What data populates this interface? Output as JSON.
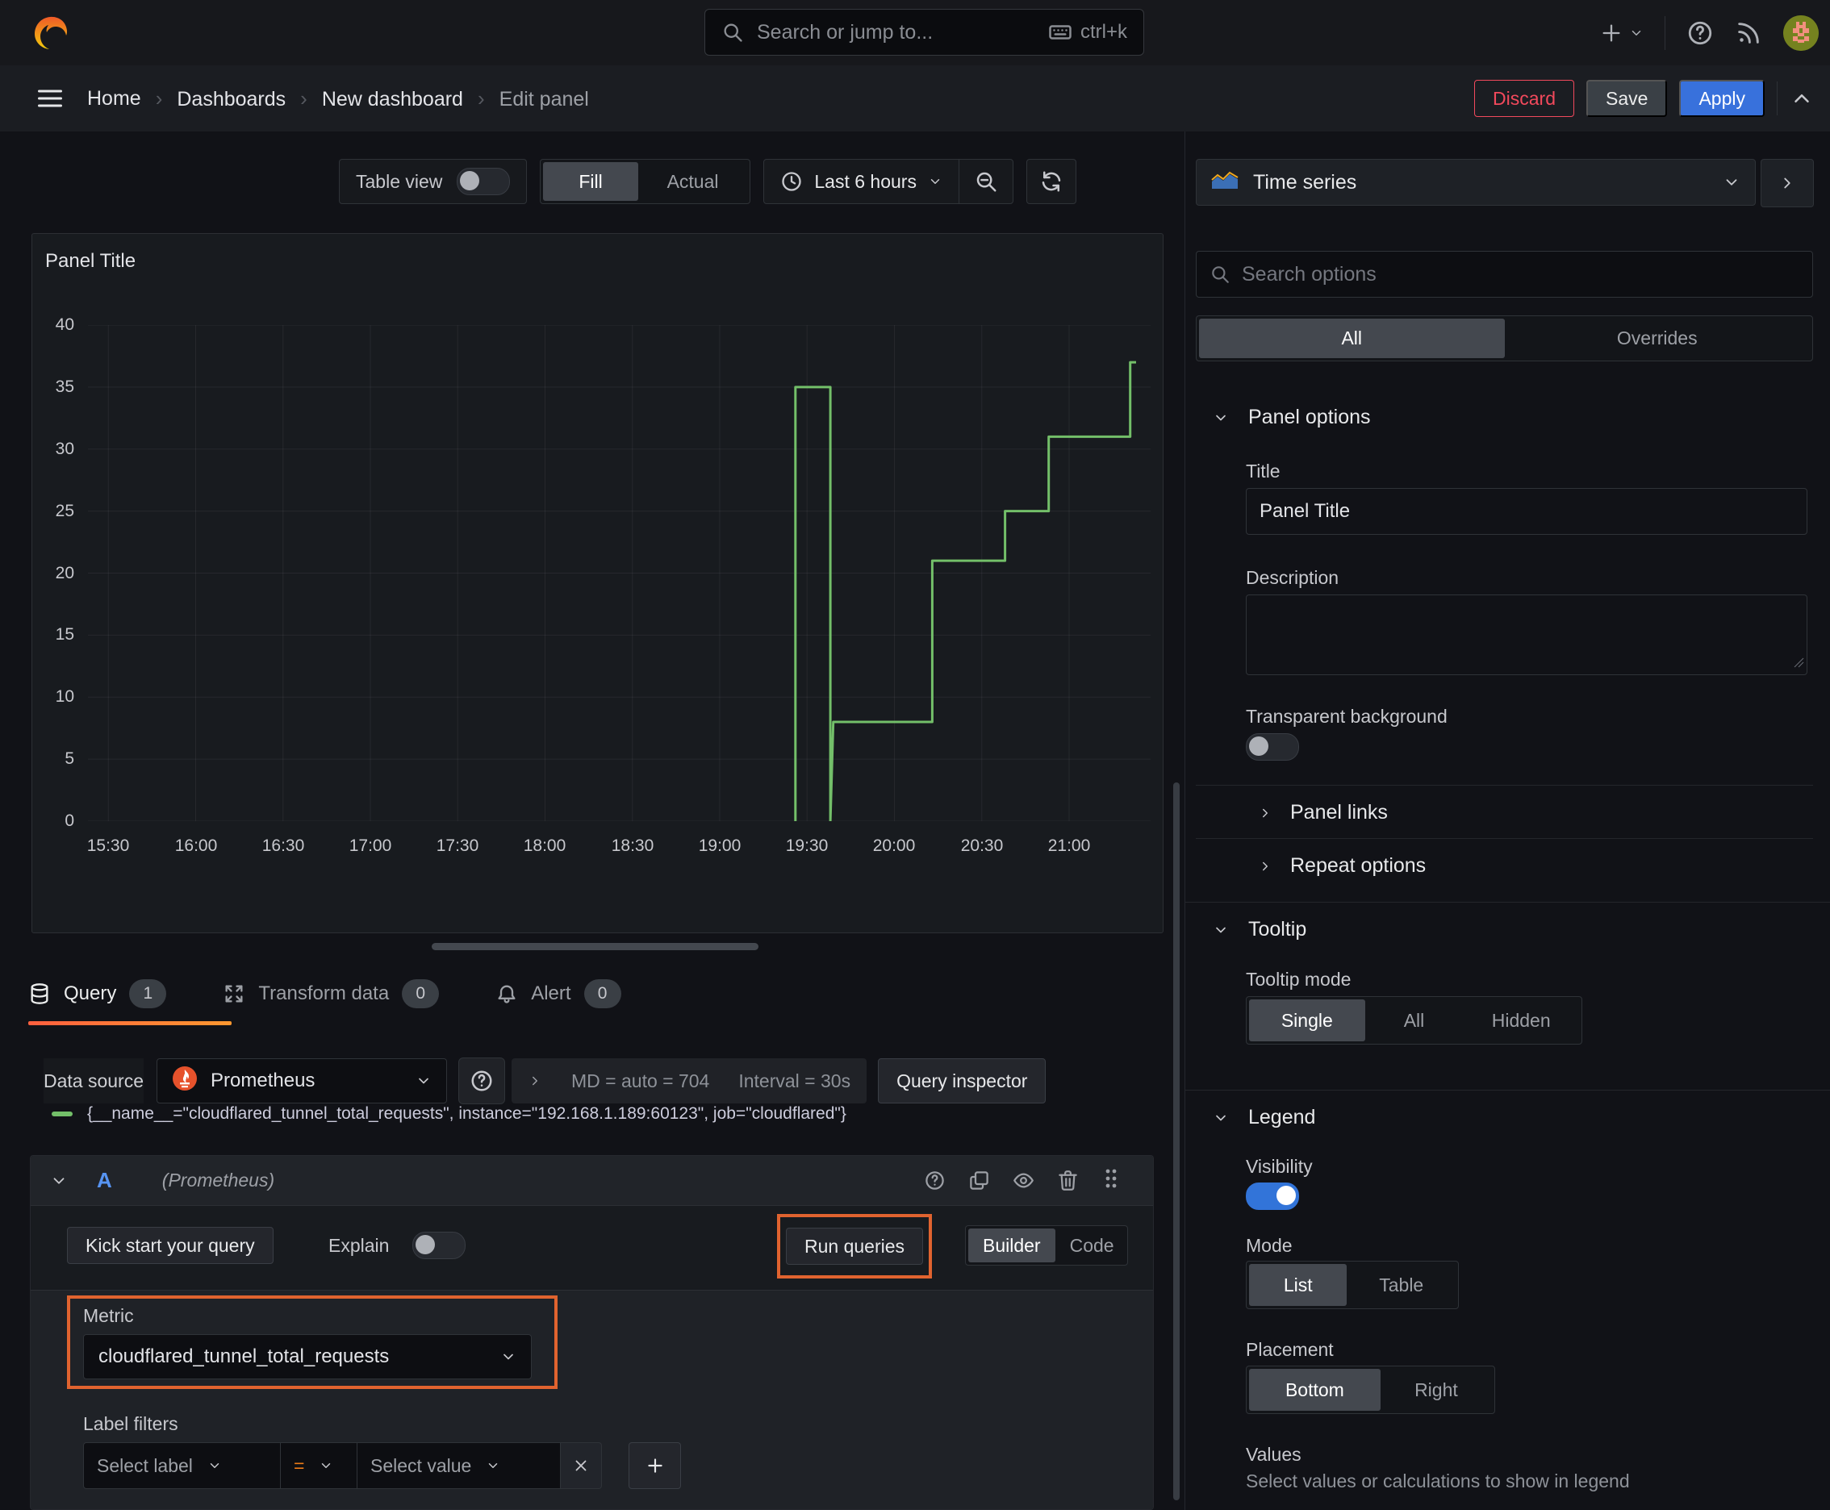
{
  "topbar": {
    "search_placeholder": "Search or jump to...",
    "shortcut": "ctrl+k"
  },
  "breadcrumb": {
    "items": [
      "Home",
      "Dashboards",
      "New dashboard",
      "Edit panel"
    ]
  },
  "actions": {
    "discard": "Discard",
    "save": "Save",
    "apply": "Apply"
  },
  "toolbar": {
    "table_view": "Table view",
    "fill": "Fill",
    "actual": "Actual",
    "time_range": "Last 6 hours"
  },
  "panel": {
    "title": "Panel Title"
  },
  "chart_data": {
    "type": "line",
    "title": "Panel Title",
    "x_ticks": [
      "15:30",
      "16:00",
      "16:30",
      "17:00",
      "17:30",
      "18:00",
      "18:30",
      "19:00",
      "19:30",
      "20:00",
      "20:30",
      "21:00"
    ],
    "x_tick_minutes": [
      930,
      960,
      990,
      1020,
      1050,
      1080,
      1110,
      1140,
      1170,
      1200,
      1230,
      1260
    ],
    "x_domain_minutes": [
      923,
      1288
    ],
    "y_ticks": [
      0,
      5,
      10,
      15,
      20,
      25,
      30,
      35,
      40
    ],
    "ylim": [
      0,
      40
    ],
    "grid": true,
    "legend_position": "bottom",
    "series": [
      {
        "name": "{__name__=\"cloudflared_tunnel_total_requests\", instance=\"192.168.1.189:60123\", job=\"cloudflared\"}",
        "color": "#73bf69",
        "points": [
          [
            1166,
            0
          ],
          [
            1166,
            35
          ],
          [
            1178,
            35
          ],
          [
            1178,
            0
          ],
          [
            1179,
            8
          ],
          [
            1213,
            8
          ],
          [
            1213,
            21
          ],
          [
            1238,
            21
          ],
          [
            1238,
            25
          ],
          [
            1253,
            25
          ],
          [
            1253,
            31
          ],
          [
            1281,
            31
          ],
          [
            1281,
            37
          ],
          [
            1283,
            37
          ]
        ]
      }
    ]
  },
  "tabs": [
    {
      "label": "Query",
      "count": "1"
    },
    {
      "label": "Transform data",
      "count": "0"
    },
    {
      "label": "Alert",
      "count": "0"
    }
  ],
  "datasource": {
    "label": "Data source",
    "name": "Prometheus",
    "max_data_points": "MD = auto = 704",
    "interval": "Interval = 30s",
    "inspector": "Query inspector"
  },
  "query": {
    "ref_id": "A",
    "ds_hint": "(Prometheus)",
    "kick_start": "Kick start your query",
    "explain": "Explain",
    "run": "Run queries",
    "builder": "Builder",
    "code": "Code",
    "metric_label": "Metric",
    "metric_value": "cloudflared_tunnel_total_requests",
    "label_filters": "Label filters",
    "select_label": "Select label",
    "operator": "=",
    "select_value": "Select value"
  },
  "sidebar": {
    "visualization": "Time series",
    "search_placeholder": "Search options",
    "tabs": {
      "all": "All",
      "overrides": "Overrides"
    },
    "panel_options": {
      "header": "Panel options",
      "title_label": "Title",
      "title_value": "Panel Title",
      "description_label": "Description",
      "transparent": "Transparent background"
    },
    "collapsed": {
      "links": "Panel links",
      "repeat": "Repeat options"
    },
    "tooltip": {
      "header": "Tooltip",
      "mode_label": "Tooltip mode",
      "options": [
        "Single",
        "All",
        "Hidden"
      ]
    },
    "legend": {
      "header": "Legend",
      "visibility": "Visibility",
      "mode_label": "Mode",
      "modes": [
        "List",
        "Table"
      ],
      "placement_label": "Placement",
      "placements": [
        "Bottom",
        "Right"
      ],
      "values_label": "Values",
      "values_help": "Select values or calculations to show in legend"
    }
  },
  "colors": {
    "accent_orange": "#e0632f",
    "series_green": "#73bf69",
    "apply_blue": "#3871dc",
    "discard_pink": "#f2495c",
    "toggle_blue": "#3274d9"
  }
}
